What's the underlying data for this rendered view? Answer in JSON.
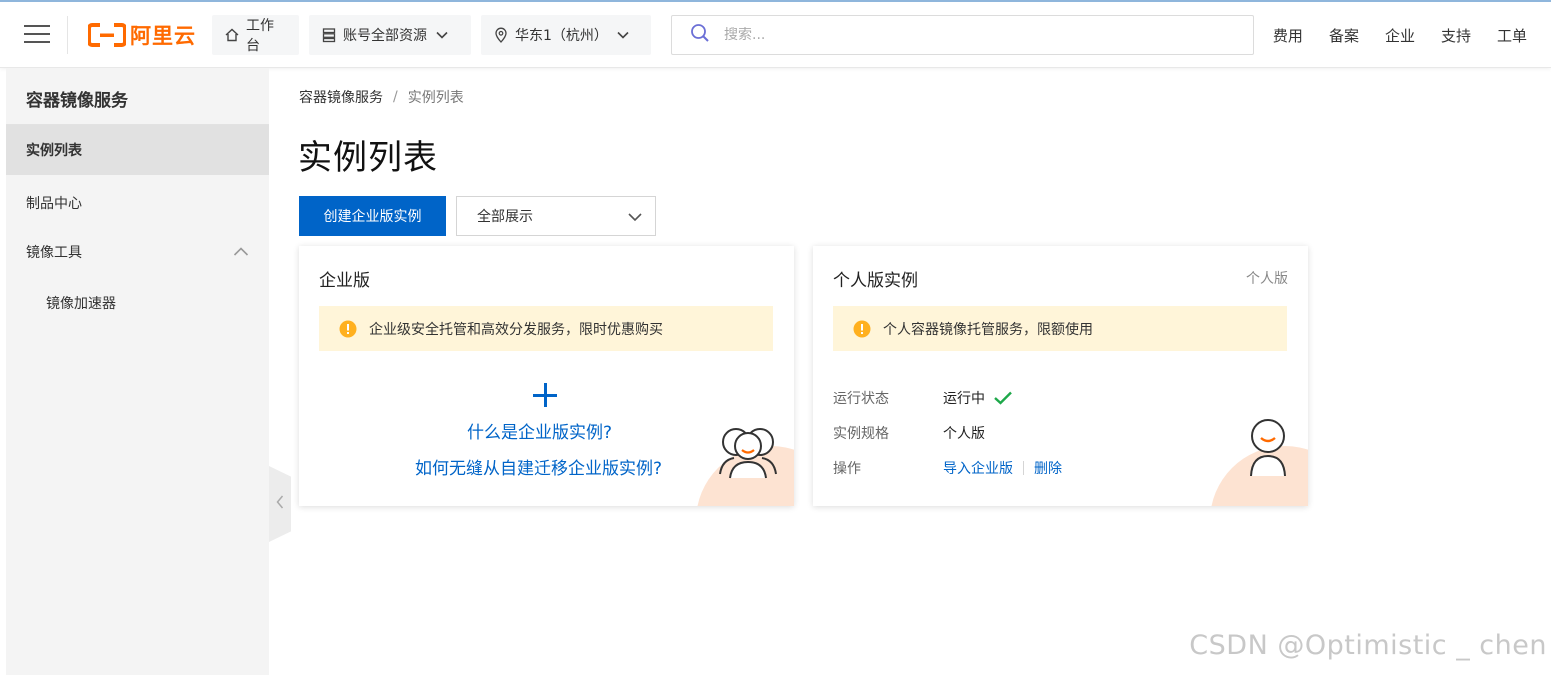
{
  "topbar": {
    "logo_text": "阿里云",
    "brand_color": "#ff6a00",
    "workbench_label": "工作台",
    "resource_label": "账号全部资源",
    "region_label": "华东1（杭州）",
    "search_placeholder": "搜索...",
    "nav": [
      "费用",
      "备案",
      "企业",
      "支持",
      "工单"
    ]
  },
  "sidebar": {
    "title": "容器镜像服务",
    "items": [
      {
        "label": "实例列表",
        "active": true
      },
      {
        "label": "制品中心"
      },
      {
        "label": "镜像工具",
        "expanded": true
      },
      {
        "label": "镜像加速器",
        "sub": true
      }
    ]
  },
  "breadcrumb": [
    "容器镜像服务",
    "实例列表"
  ],
  "page": {
    "title": "实例列表",
    "create_button": "创建企业版实例",
    "filter_select": "全部展示",
    "accent_color": "#0064c8"
  },
  "enterprise_card": {
    "title": "企业版",
    "notice": "企业级安全托管和高效分发服务，限时优惠购买",
    "link_what": "什么是企业版实例?",
    "link_migrate": "如何无缝从自建迁移企业版实例?"
  },
  "personal_card": {
    "title": "个人版实例",
    "tag": "个人版",
    "notice": "个人容器镜像托管服务，限额使用",
    "status_key": "运行状态",
    "status_value": "运行中",
    "spec_key": "实例规格",
    "spec_value": "个人版",
    "ops_key": "操作",
    "op_import": "导入企业版",
    "op_delete": "删除"
  },
  "watermark": "CSDN @Optimistic _ chen"
}
